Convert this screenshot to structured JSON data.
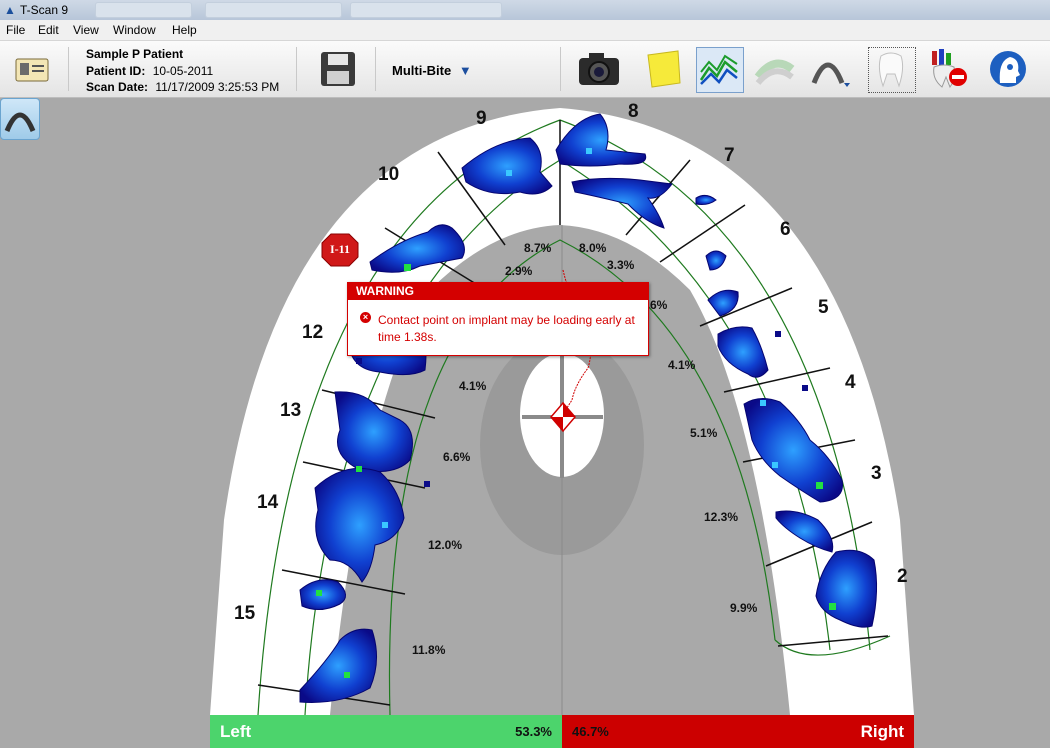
{
  "app": {
    "title": "T-Scan 9"
  },
  "menu": [
    "File",
    "Edit",
    "View",
    "Window",
    "Help"
  ],
  "patient": {
    "name": "Sample P Patient",
    "id_label": "Patient ID:",
    "id_value": "10-05-2011",
    "date_label": "Scan Date:",
    "date_value": "11/17/2009 3:25:53 PM"
  },
  "toolbar": {
    "mode_label": "Multi-Bite",
    "icons": [
      "id-card-icon",
      "save-icon",
      "camera-icon",
      "sticky-note-icon",
      "graph-icon",
      "arch-overlay-icon",
      "arch-icon",
      "tooth-icon",
      "no-implant-icon",
      "help-head-icon"
    ]
  },
  "warning": {
    "header": "WARNING",
    "message": "Contact point on implant may be loading early at time 1.38s."
  },
  "implant_badge": "I-11",
  "teeth_numbers": [
    "9",
    "8",
    "10",
    "7",
    "6",
    "5",
    "12",
    "4",
    "13",
    "3",
    "14",
    "2",
    "15"
  ],
  "percentages": [
    "8.7%",
    "8.0%",
    "2.9%",
    "3.3%",
    "6%",
    "4.1%",
    "4.1%",
    "5.1%",
    "6.6%",
    "12.3%",
    "12.0%",
    "9.9%",
    "11.8%"
  ],
  "balance": {
    "left_label": "Left",
    "left_value": "53.3%",
    "right_value": "46.7%",
    "right_label": "Right"
  },
  "colors": {
    "left": "#4cd46c",
    "right": "#cc0000",
    "contact": "#1010a0"
  }
}
